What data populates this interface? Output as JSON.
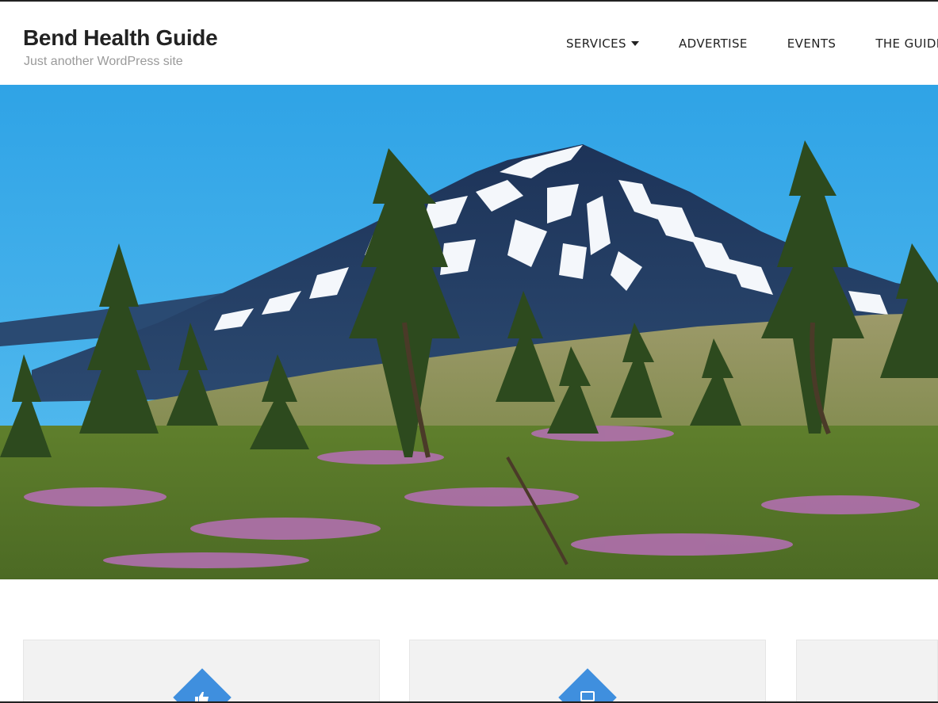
{
  "site": {
    "title": "Bend Health Guide",
    "tagline": "Just another WordPress site"
  },
  "nav": {
    "items": [
      {
        "label": "SERVICES",
        "has_dropdown": true
      },
      {
        "label": "ADVERTISE",
        "has_dropdown": false
      },
      {
        "label": "EVENTS",
        "has_dropdown": false
      },
      {
        "label": "THE GUIDE",
        "has_dropdown": false
      }
    ]
  },
  "features": {
    "items": [
      {
        "icon": "thumbs-up-icon"
      },
      {
        "icon": "laptop-icon"
      },
      {
        "icon": ""
      }
    ],
    "accent_color": "#3f8fde"
  },
  "colors": {
    "sky": "#3aa9e8",
    "text": "#222222",
    "tagline": "#9a9a9a",
    "card_bg": "#f2f2f2"
  }
}
